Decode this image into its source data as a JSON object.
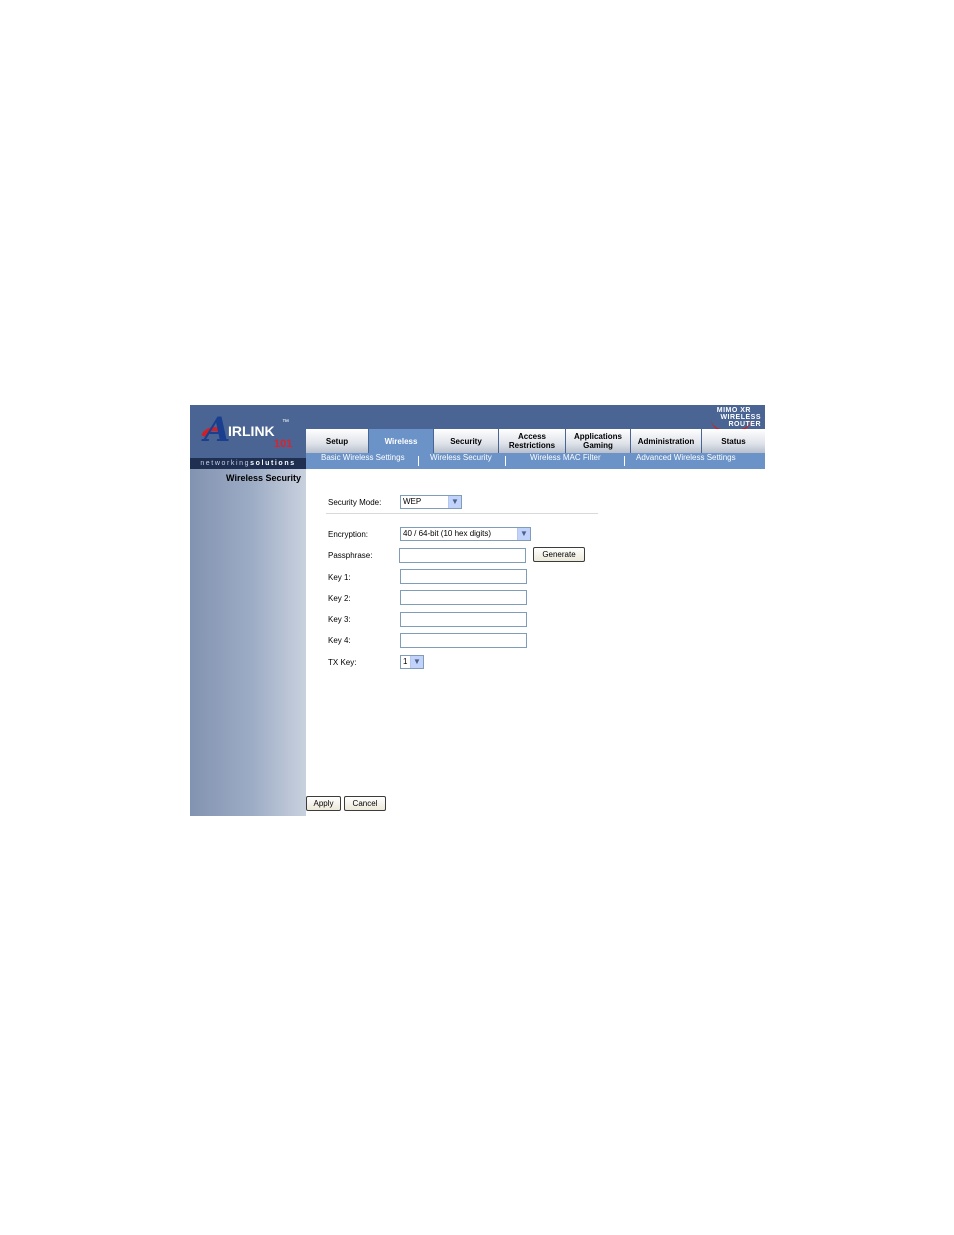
{
  "brand": {
    "logo_a": "A",
    "logo_text": "IRLINK",
    "logo_tm": "™",
    "logo_number": "101",
    "tagline_prefix": "networking",
    "tagline_bold": "solutions",
    "badge_line1": "MIMO XR",
    "badge_line2": "WIRELESS ROUTER"
  },
  "tabs": [
    {
      "label": "Setup",
      "active": false
    },
    {
      "label": "Wireless",
      "active": true
    },
    {
      "label": "Security",
      "active": false
    },
    {
      "label": "Access Restrictions",
      "active": false
    },
    {
      "label": "Applications Gaming",
      "active": false
    },
    {
      "label": "Administration",
      "active": false
    },
    {
      "label": "Status",
      "active": false
    }
  ],
  "subtabs": [
    {
      "label": "Basic Wireless Settings"
    },
    {
      "label": "Wireless Security"
    },
    {
      "label": "Wireless MAC Filter"
    },
    {
      "label": "Advanced Wireless Settings"
    }
  ],
  "sidebar": {
    "title": "Wireless Security"
  },
  "form": {
    "security_mode": {
      "label": "Security Mode:",
      "value": "WEP"
    },
    "encryption": {
      "label": "Encryption:",
      "value": "40 / 64-bit (10 hex digits)"
    },
    "passphrase": {
      "label": "Passphrase:",
      "value": ""
    },
    "generate_label": "Generate",
    "key1": {
      "label": "Key 1:",
      "value": ""
    },
    "key2": {
      "label": "Key 2:",
      "value": ""
    },
    "key3": {
      "label": "Key 3:",
      "value": ""
    },
    "key4": {
      "label": "Key 4:",
      "value": ""
    },
    "tx_key": {
      "label": "TX Key:",
      "value": "1"
    }
  },
  "actions": {
    "apply_label": "Apply",
    "cancel_label": "Cancel"
  },
  "colors": {
    "header": "#4a6593",
    "active_tab": "#6b93c8",
    "subnav": "#6b93c8",
    "accent_red": "#d21f25"
  }
}
